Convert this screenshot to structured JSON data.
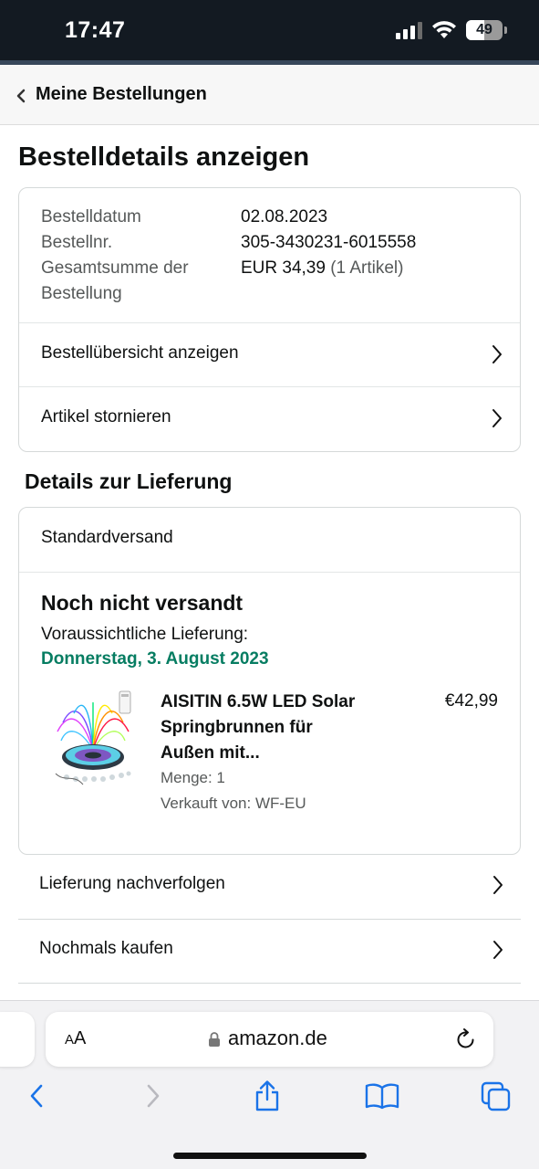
{
  "status_bar": {
    "time": "17:47",
    "battery": "49"
  },
  "nav": {
    "back_label": "Meine Bestellungen"
  },
  "page_title": "Bestelldetails anzeigen",
  "summary": {
    "order_date_label": "Bestelldatum",
    "order_date_value": "02.08.2023",
    "order_number_label": "Bestellnr.",
    "order_number_value": "305-3430231-6015558",
    "total_label_line1": "Gesamtsumme der",
    "total_label_line2": "Bestellung",
    "total_value": "EUR 34,39",
    "total_items": "(1 Artikel)"
  },
  "actions": {
    "view_overview": "Bestellübersicht anzeigen",
    "cancel_items": "Artikel stornieren"
  },
  "delivery": {
    "section_title": "Details zur Lieferung",
    "shipping_method": "Standardversand",
    "status": "Noch nicht versandt",
    "eta_label": "Voraussichtliche Lieferung:",
    "eta_date": "Donnerstag, 3. August 2023",
    "product": {
      "title_line1": "AISITIN 6.5W LED Solar",
      "title_line2": "Springbrunnen für",
      "title_line3": "Außen mit...",
      "price": "€42,99",
      "quantity": "Menge: 1",
      "seller": "Verkauft von: WF-EU"
    }
  },
  "more_actions": {
    "track": "Lieferung nachverfolgen",
    "buy_again": "Nochmals kaufen"
  },
  "browser": {
    "text_size_label_small": "A",
    "text_size_label_large": "A",
    "url": "amazon.de"
  },
  "colors": {
    "status_bar_bg": "#131a22",
    "delivery_date_green": "#067d62",
    "safari_blue": "#1a73e8"
  }
}
